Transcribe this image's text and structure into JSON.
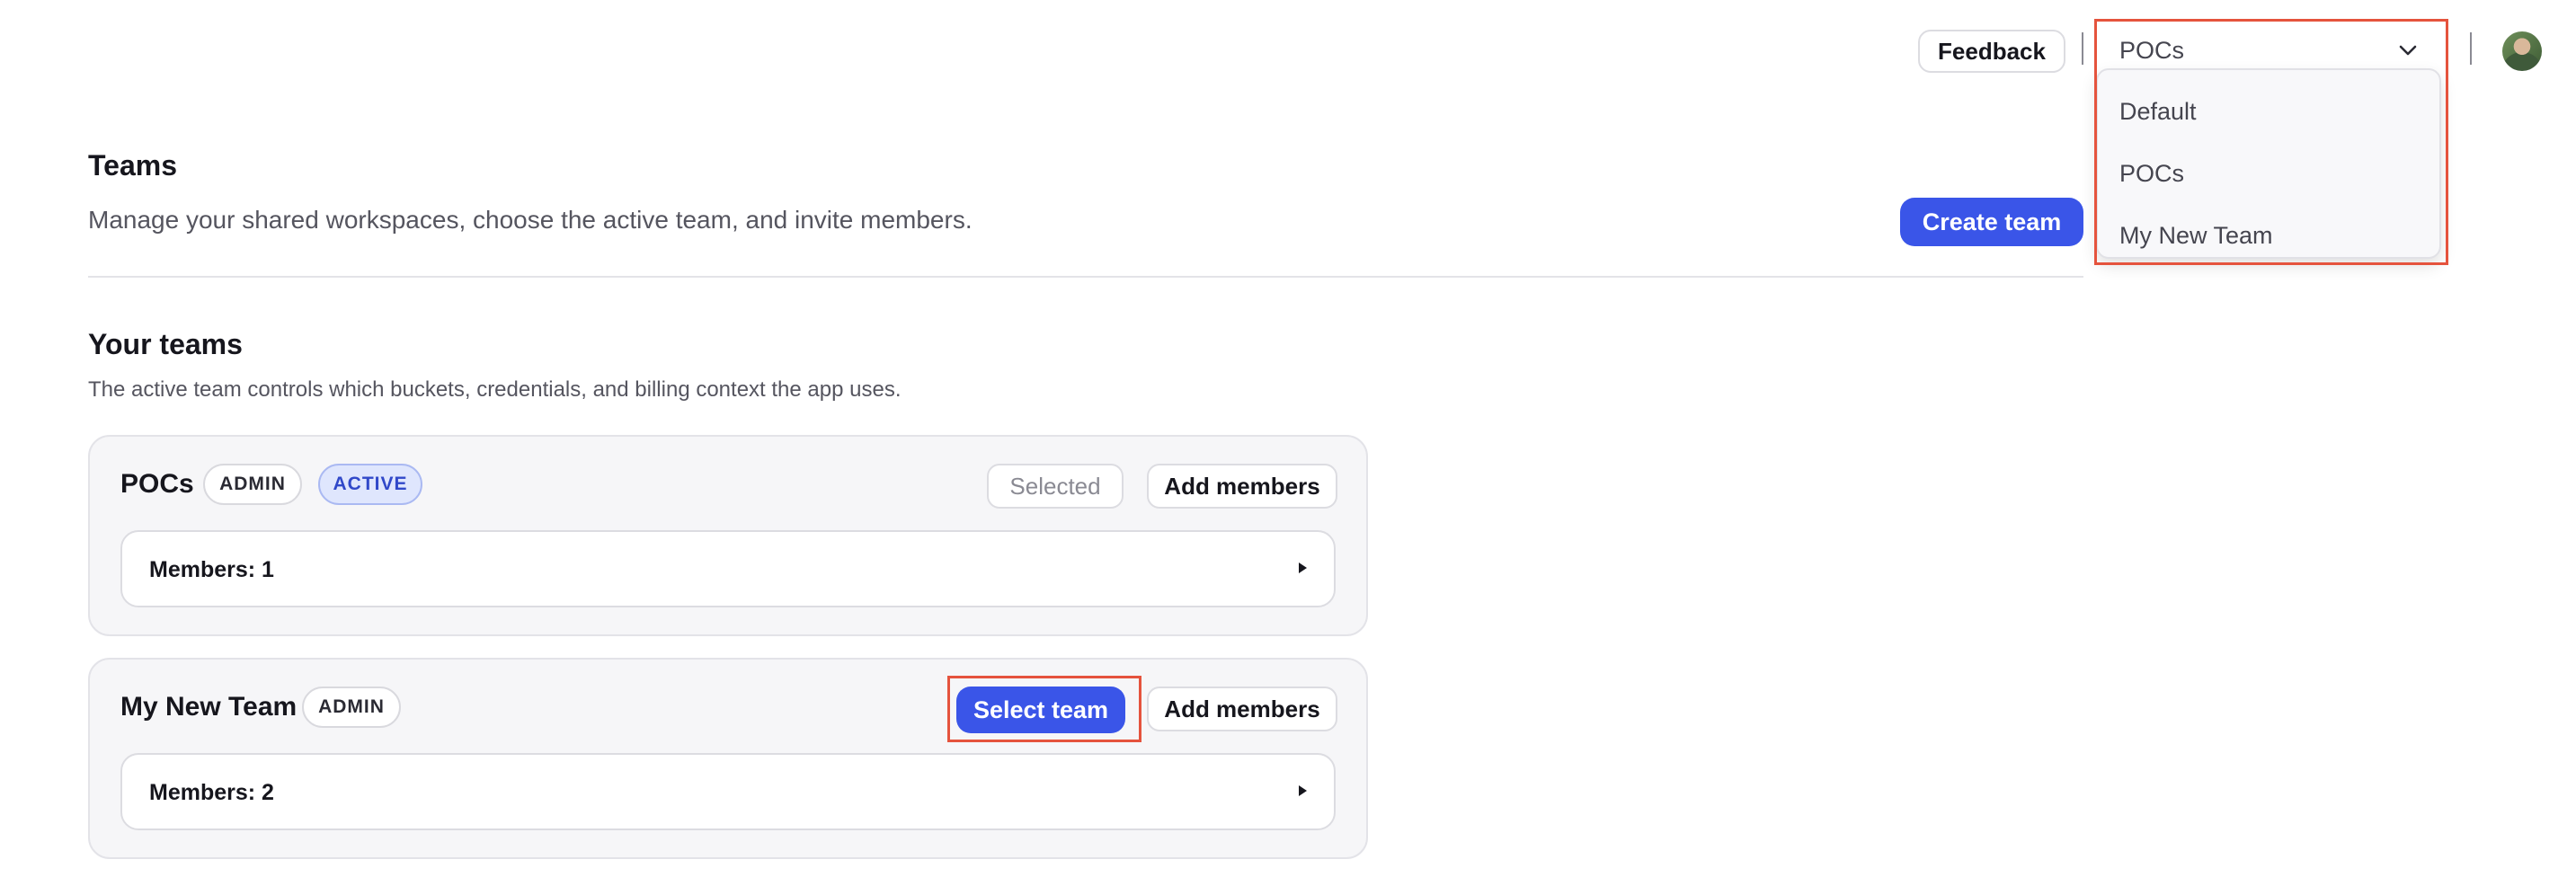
{
  "topbar": {
    "feedback_label": "Feedback",
    "team_selector": {
      "selected": "POCs",
      "options": [
        "Default",
        "POCs",
        "My New Team"
      ]
    }
  },
  "header": {
    "title": "Teams",
    "subtitle": "Manage your shared workspaces, choose the active team, and invite members.",
    "create_label": "Create team"
  },
  "teams_section": {
    "title": "Your teams",
    "description": "The active team controls which buckets, credentials, and billing context the app uses."
  },
  "teams": [
    {
      "name": "POCs",
      "role_badge": "ADMIN",
      "active_badge": "ACTIVE",
      "select_label": "Selected",
      "add_label": "Add members",
      "members_label": "Members: 1"
    },
    {
      "name": "My New Team",
      "role_badge": "ADMIN",
      "select_label": "Select team",
      "add_label": "Add members",
      "members_label": "Members: 2"
    }
  ],
  "colors": {
    "accent": "#3a55e8",
    "highlight": "#e5533d",
    "active_badge_bg": "#dfe6fd"
  }
}
